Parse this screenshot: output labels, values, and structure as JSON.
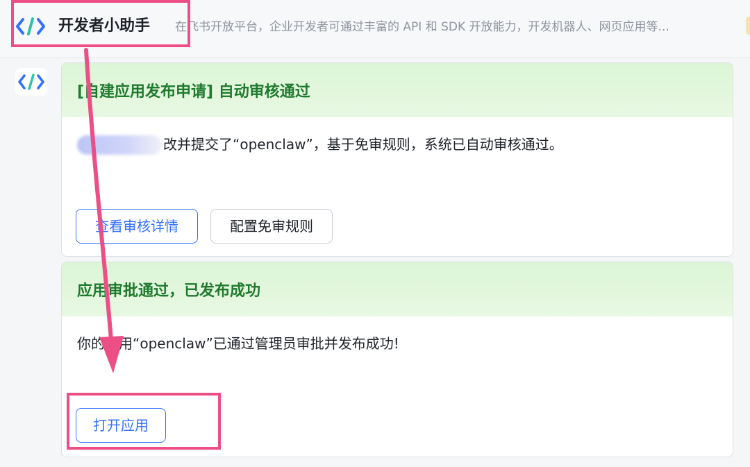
{
  "header": {
    "title": "开发者小助手",
    "description": "在飞书开放平台，企业开发者可通过丰富的 API 和 SDK 开放能力，开发机器人、网页应用等..."
  },
  "cards": [
    {
      "title": "[自建应用发布申请] 自动审核通过",
      "body_text": "改并提交了“openclaw”，基于免审规则，系统已自动审核通过。",
      "buttons": [
        "查看审核详情",
        "配置免审规则"
      ]
    },
    {
      "title": "应用审批通过，已发布成功",
      "body_text": "你的应用“openclaw”已通过管理员审批并发布成功!",
      "buttons": [
        "打开应用"
      ]
    }
  ],
  "colors": {
    "accent": "#3370ff",
    "success_title": "#1f7a2e",
    "highlight": "#ec4f86"
  },
  "icons": {
    "bot_logo": "code-brackets-icon",
    "annotation": "arrow-icon"
  }
}
